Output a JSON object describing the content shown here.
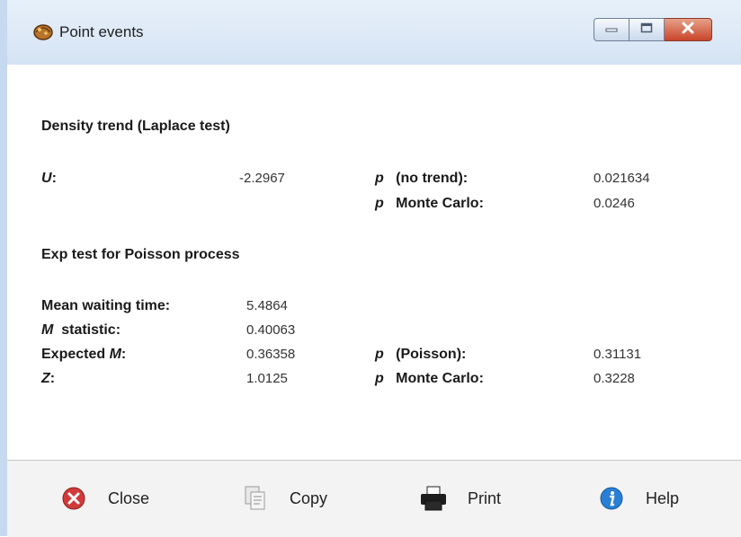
{
  "window": {
    "title": "Point events",
    "icon": "app-shell-icon",
    "controls": {
      "minimize": "minimize-icon",
      "maximize": "maximize-icon",
      "close": "close-icon"
    }
  },
  "density": {
    "heading": "Density trend (Laplace test)",
    "u_label": "U",
    "u_colon": ":",
    "u_value": "-2.2967",
    "p_symbol": "p",
    "p_no_trend_label": "(no trend):",
    "p_no_trend_value": "0.021634",
    "p_mc_label": "Monte Carlo:",
    "p_mc_value": "0.0246"
  },
  "exp": {
    "heading": "Exp test for Poisson process",
    "mean_label": "Mean waiting time:",
    "mean_value": "5.4864",
    "m_symbol": "M",
    "m_label": "statistic:",
    "m_value": "0.40063",
    "expected_label": "Expected",
    "expected_symbol": "M",
    "expected_colon": ":",
    "expected_value": "0.36358",
    "p_symbol": "p",
    "p_poisson_label": "(Poisson):",
    "p_poisson_value": "0.31131",
    "z_label": "Z",
    "z_colon": ":",
    "z_value": "1.0125",
    "p_mc_label": "Monte Carlo:",
    "p_mc_value": "0.3228"
  },
  "buttons": {
    "close": {
      "label": "Close",
      "icon": "close-circle-icon"
    },
    "copy": {
      "label": "Copy",
      "icon": "copy-icon"
    },
    "print": {
      "label": "Print",
      "icon": "printer-icon"
    },
    "help": {
      "label": "Help",
      "icon": "info-icon"
    }
  },
  "colors": {
    "titlebar": "#dfeaf7",
    "close_button": "#c8452a",
    "help_icon": "#2a7fd4",
    "close_icon": "#d23a3a"
  }
}
